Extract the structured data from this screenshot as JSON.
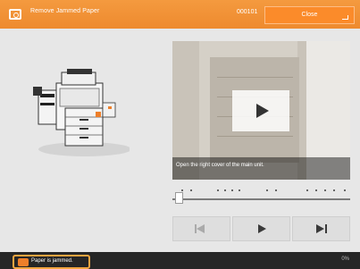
{
  "header": {
    "title": "Remove Jammed Paper",
    "code": "000101",
    "close_label": "Close"
  },
  "video": {
    "caption": "Open the right cover of the main unit.",
    "play_icon": "play-icon"
  },
  "controls": {
    "prev_icon": "skip-previous-icon",
    "play_icon": "play-icon",
    "next_icon": "skip-next-icon"
  },
  "status": {
    "message": "Paper is jammed.",
    "percent": "0%"
  },
  "colors": {
    "header": "#ef8c30",
    "status_outline": "#f2a540",
    "status_bar": "#262626"
  }
}
